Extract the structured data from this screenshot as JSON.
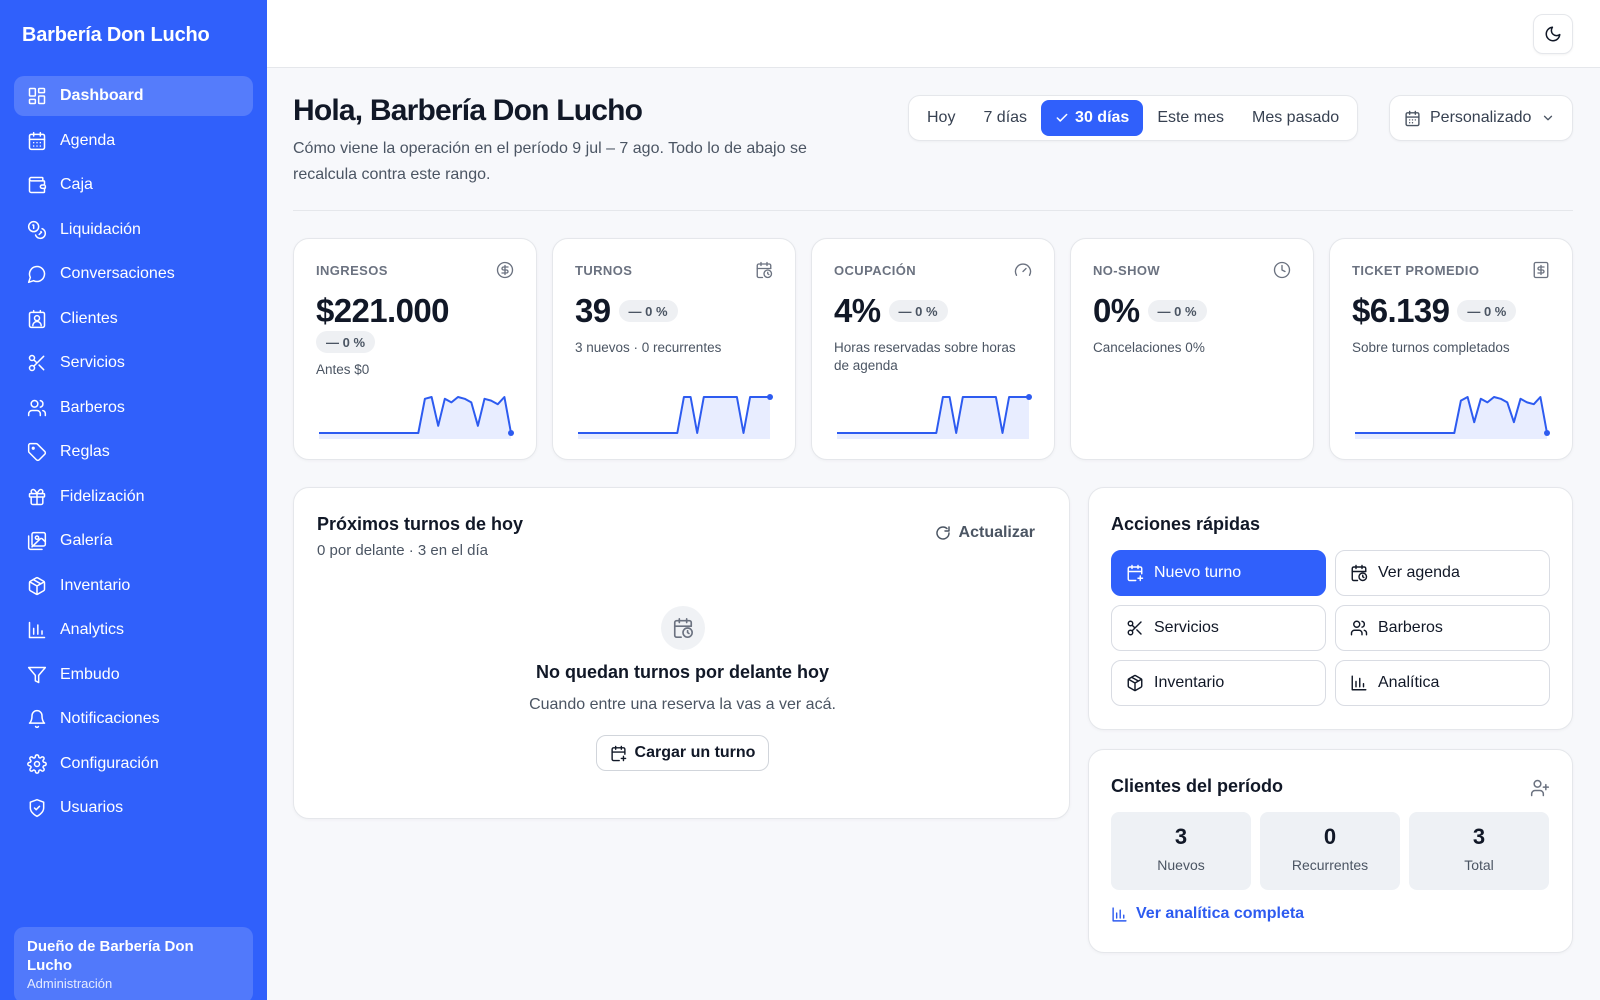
{
  "sidebar": {
    "brand": "Barbería Don Lucho",
    "items": [
      {
        "label": "Dashboard",
        "icon": "dashboard-icon",
        "active": true
      },
      {
        "label": "Agenda",
        "icon": "calendar-icon"
      },
      {
        "label": "Caja",
        "icon": "wallet-icon"
      },
      {
        "label": "Liquidación",
        "icon": "coins-icon"
      },
      {
        "label": "Conversaciones",
        "icon": "chat-icon"
      },
      {
        "label": "Clientes",
        "icon": "contact-icon"
      },
      {
        "label": "Servicios",
        "icon": "scissors-icon"
      },
      {
        "label": "Barberos",
        "icon": "users-icon"
      },
      {
        "label": "Reglas",
        "icon": "tag-icon"
      },
      {
        "label": "Fidelización",
        "icon": "gift-icon"
      },
      {
        "label": "Galería",
        "icon": "images-icon"
      },
      {
        "label": "Inventario",
        "icon": "package-icon"
      },
      {
        "label": "Analytics",
        "icon": "bar-chart-icon"
      },
      {
        "label": "Embudo",
        "icon": "funnel-icon"
      },
      {
        "label": "Notificaciones",
        "icon": "bell-icon"
      },
      {
        "label": "Configuración",
        "icon": "gear-icon"
      },
      {
        "label": "Usuarios",
        "icon": "shield-icon"
      }
    ],
    "user": {
      "name": "Dueño de Barbería Don Lucho",
      "role": "Administración"
    }
  },
  "header": {
    "greeting": "Hola, Barbería Don Lucho",
    "subtitle": "Cómo viene la operación en el período 9 jul – 7 ago. Todo lo de abajo se recalcula contra este rango.",
    "ranges": [
      {
        "label": "Hoy"
      },
      {
        "label": "7 días"
      },
      {
        "label": "30 días",
        "active": true
      },
      {
        "label": "Este mes"
      },
      {
        "label": "Mes pasado"
      }
    ],
    "custom_label": "Personalizado"
  },
  "kpis": [
    {
      "label": "INGRESOS",
      "icon": "dollar-circle-icon",
      "value": "$221.000",
      "delta": "— 0 %",
      "sub": "Antes $0",
      "spark": [
        0,
        0,
        0,
        0,
        0,
        0,
        0,
        0,
        0,
        0,
        0,
        0,
        0,
        0,
        0,
        0,
        0.95,
        1,
        0.2,
        0.95,
        0.85,
        1,
        0.95,
        0.85,
        0.2,
        0.95,
        0.9,
        0.8,
        1,
        0
      ]
    },
    {
      "label": "TURNOS",
      "icon": "calendar-clock-icon",
      "value": "39",
      "delta": "— 0 %",
      "sub": "3 nuevos · 0 recurrentes",
      "spark": [
        0,
        0,
        0,
        0,
        0,
        0,
        0,
        0,
        0,
        0,
        0,
        0,
        0,
        0,
        0,
        0,
        1,
        1,
        0,
        1,
        1,
        1,
        1,
        1,
        1,
        0,
        1,
        1,
        1,
        1
      ]
    },
    {
      "label": "OCUPACIÓN",
      "icon": "gauge-icon",
      "value": "4%",
      "delta": "— 0 %",
      "sub": "Horas reservadas sobre horas de agenda",
      "spark": [
        0,
        0,
        0,
        0,
        0,
        0,
        0,
        0,
        0,
        0,
        0,
        0,
        0,
        0,
        0,
        0,
        1,
        1,
        0,
        1,
        1,
        1,
        1,
        1,
        1,
        0,
        1,
        1,
        1,
        1
      ]
    },
    {
      "label": "NO-SHOW",
      "icon": "clock-icon",
      "value": "0%",
      "delta": "— 0 %",
      "sub": "Cancelaciones 0%",
      "spark": []
    },
    {
      "label": "TICKET PROMEDIO",
      "icon": "receipt-icon",
      "value": "$6.139",
      "delta": "— 0 %",
      "sub": "Sobre turnos completados",
      "spark": [
        0,
        0,
        0,
        0,
        0,
        0,
        0,
        0,
        0,
        0,
        0,
        0,
        0,
        0,
        0,
        0,
        0.9,
        1,
        0.3,
        0.95,
        0.85,
        1,
        0.95,
        0.85,
        0.3,
        0.95,
        0.85,
        0.8,
        1,
        0
      ]
    }
  ],
  "next_appointments": {
    "title": "Próximos turnos de hoy",
    "subtitle": "0 por delante · 3 en el día",
    "refresh_label": "Actualizar",
    "empty_title": "No quedan turnos por delante hoy",
    "empty_sub": "Cuando entre una reserva la vas a ver acá.",
    "load_label": "Cargar un turno"
  },
  "quick_actions": {
    "title": "Acciones rápidas",
    "items": [
      {
        "label": "Nuevo turno",
        "icon": "calendar-plus-icon",
        "primary": true
      },
      {
        "label": "Ver agenda",
        "icon": "calendar-clock-icon"
      },
      {
        "label": "Servicios",
        "icon": "scissors-icon"
      },
      {
        "label": "Barberos",
        "icon": "users-icon"
      },
      {
        "label": "Inventario",
        "icon": "package-icon"
      },
      {
        "label": "Analítica",
        "icon": "bar-chart-icon"
      }
    ]
  },
  "clients": {
    "title": "Clientes del período",
    "stats": [
      {
        "value": "3",
        "label": "Nuevos"
      },
      {
        "value": "0",
        "label": "Recurrentes"
      },
      {
        "value": "3",
        "label": "Total"
      }
    ],
    "link_label": "Ver analítica completa"
  },
  "colors": {
    "accent": "#3060fb",
    "sidebar": "#3060fb",
    "spark_line": "#2d5bf0",
    "spark_fill": "#e8edff"
  }
}
